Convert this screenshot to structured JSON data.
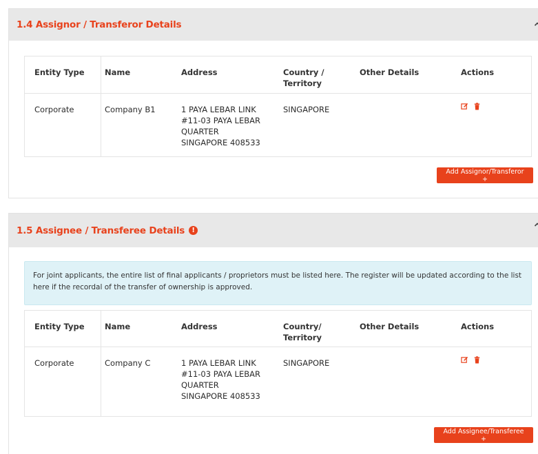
{
  "assignor_section": {
    "title": "1.4 Assignor / Transferor Details",
    "table": {
      "headers": [
        "Entity Type",
        "Name",
        "Address",
        "Country / Territory",
        "Other Details",
        "Actions"
      ],
      "rows": [
        {
          "entity_type": "Corporate",
          "name": "Company B1",
          "address": [
            "1 PAYA LEBAR LINK",
            "#11-03 PAYA LEBAR",
            "QUARTER",
            "SINGAPORE 408533"
          ],
          "country": "SINGAPORE",
          "other_details": ""
        }
      ]
    },
    "add_button_label": "Add Assignor/Transferor +"
  },
  "assignee_section": {
    "title": "1.5 Assignee / Transferee Details",
    "info_text": "For joint applicants, the entire list of final applicants / proprietors must be listed here. The register will be updated according to the list here if the recordal of the transfer of ownership is approved.",
    "table": {
      "headers": [
        "Entity Type",
        "Name",
        "Address",
        "Country/ Territory",
        "Other Details",
        "Actions"
      ],
      "rows": [
        {
          "entity_type": "Corporate",
          "name": "Company C",
          "address": [
            "1 PAYA LEBAR LINK",
            "#11-03 PAYA LEBAR",
            "QUARTER",
            "SINGAPORE 408533"
          ],
          "country": "SINGAPORE",
          "other_details": ""
        }
      ]
    },
    "add_button_label": "Add Assignee/Transferee +"
  },
  "colors": {
    "accent": "#e8421c",
    "header_bg": "#e8e8e8",
    "info_bg": "#dff2f7"
  },
  "icons": {
    "edit": "edit-icon",
    "delete": "trash-icon",
    "collapse": "chevron-up-icon",
    "info": "info-icon"
  }
}
